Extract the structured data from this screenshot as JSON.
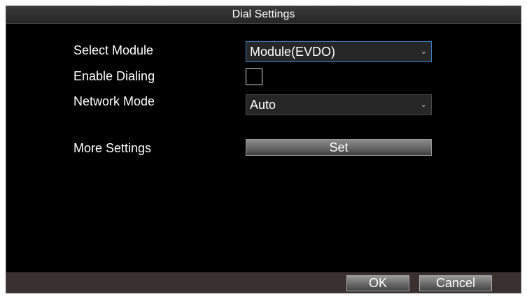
{
  "dialog": {
    "title": "Dial Settings"
  },
  "form": {
    "select_module_label": "Select Module",
    "select_module_value": "Module(EVDO)",
    "enable_dialing_label": "Enable Dialing",
    "enable_dialing_checked": false,
    "network_mode_label": "Network Mode",
    "network_mode_value": "Auto",
    "more_settings_label": "More Settings",
    "set_button": "Set"
  },
  "footer": {
    "ok_label": "OK",
    "cancel_label": "Cancel"
  },
  "icons": {
    "dropdown": "chevron-down-icon"
  },
  "colors": {
    "background": "#000000",
    "focus_border": "#3c7fc8",
    "footer": "#3a3030"
  }
}
